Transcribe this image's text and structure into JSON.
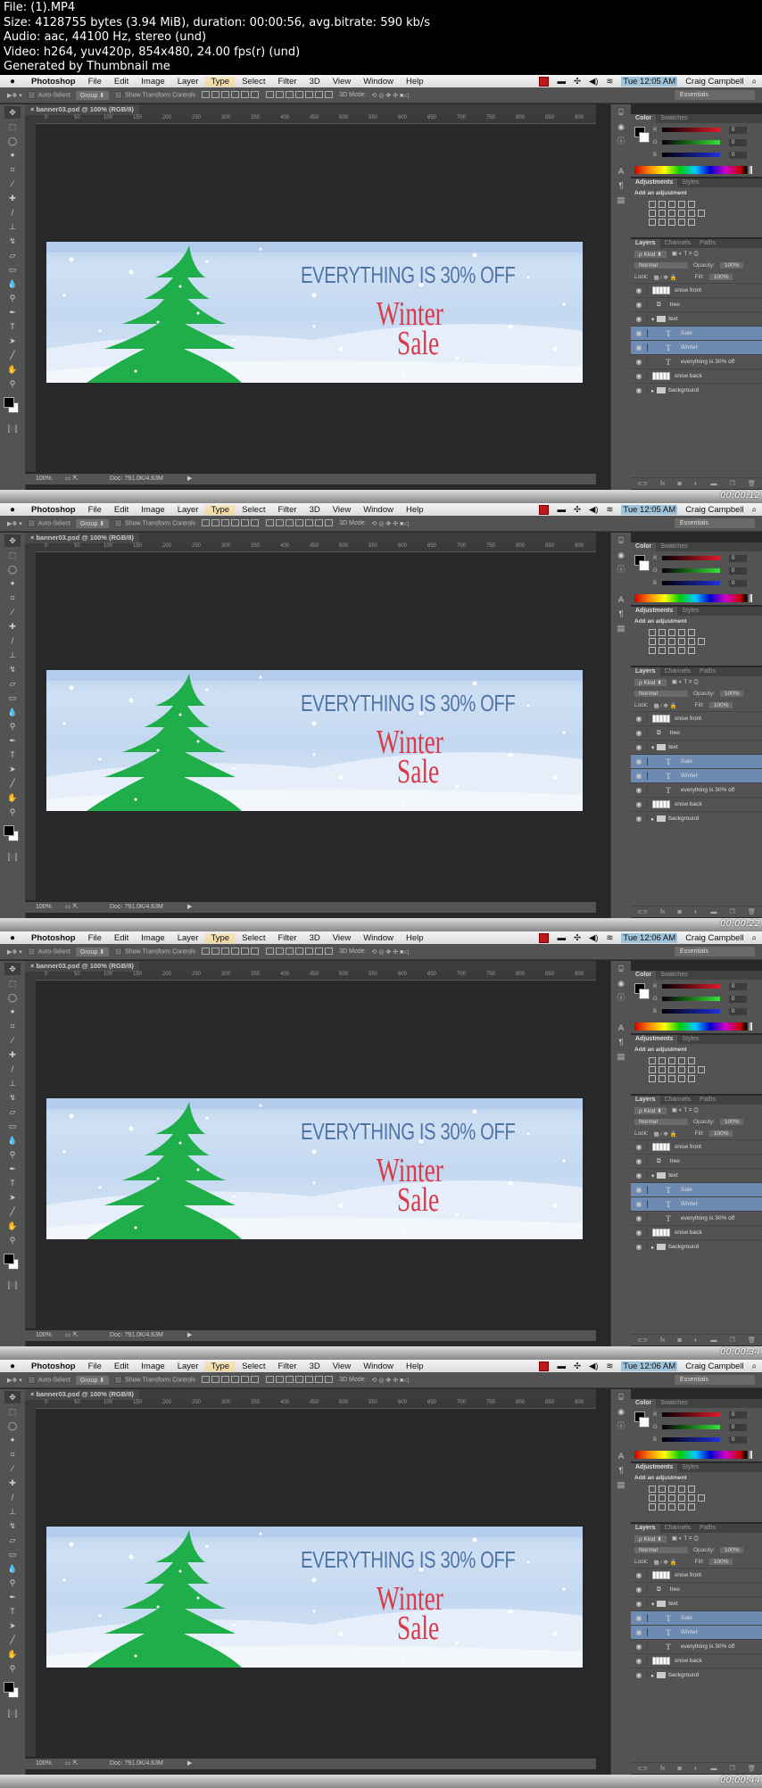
{
  "header": {
    "lines": [
      "File:  (1).MP4",
      "Size: 4128755 bytes (3.94 MiB), duration: 00:00:56, avg.bitrate: 590 kb/s",
      "Audio: aac, 44100 Hz, stereo (und)",
      "Video: h264, yuv420p, 854x480, 24.00 fps(r) (und)",
      "Generated by Thumbnail me"
    ]
  },
  "menubar": {
    "apple": "",
    "items": [
      "Photoshop",
      "File",
      "Edit",
      "Image",
      "Layer",
      "Type",
      "Select",
      "Filter",
      "3D",
      "View",
      "Window",
      "Help"
    ],
    "user": "Craig Campbell",
    "search_icon": "⌕"
  },
  "options": {
    "auto_select_label": "Auto-Select",
    "group_value": "Group ⬍",
    "show_transform_label": "Show Transform Controls",
    "mode_3d_label": "3D Mode:",
    "workspace": "Essentials"
  },
  "document": {
    "tab_title": "banner03.psd @ 100% (RGB/8)",
    "ruler_ticks": [
      "0",
      "50",
      "100",
      "150",
      "200",
      "250",
      "300",
      "350",
      "400",
      "450",
      "500",
      "550",
      "600",
      "650",
      "700",
      "750",
      "800",
      "850",
      "900"
    ],
    "zoom": "100%",
    "doc_size": "Doc: 791.0K/4.63M"
  },
  "banner": {
    "headline": "EVERYTHING IS 30% OFF",
    "line1": "Winter",
    "line2": "Sale",
    "colors": {
      "headline": "#4e74a8",
      "title": "#d83a4a",
      "tree": "#1fae4a",
      "sky": "#c3d8f0"
    }
  },
  "color_panel": {
    "tabs": [
      "Color",
      "Swatches"
    ],
    "channels": [
      {
        "label": "R",
        "value": "0"
      },
      {
        "label": "G",
        "value": "0"
      },
      {
        "label": "B",
        "value": "0"
      }
    ]
  },
  "adjustments_panel": {
    "tabs": [
      "Adjustments",
      "Styles"
    ],
    "title": "Add an adjustment"
  },
  "layers_panel": {
    "tabs": [
      "Layers",
      "Channels",
      "Paths"
    ],
    "kind_filter": "ρ Kind ⬍",
    "blend_mode": "Normal",
    "opacity_label": "Opacity:",
    "opacity_value": "100%",
    "lock_label": "Lock:",
    "fill_label": "Fill:",
    "fill_value": "100%",
    "layers": [
      {
        "name": "snow front",
        "type": "pixel",
        "selected": false
      },
      {
        "name": "tree",
        "type": "smart",
        "selected": false
      },
      {
        "name": "text",
        "type": "group-open",
        "selected": false
      },
      {
        "name": "Sale",
        "type": "text",
        "selected": true
      },
      {
        "name": "Winter",
        "type": "text",
        "selected": true
      },
      {
        "name": "everything is 30% off",
        "type": "text",
        "selected": false
      },
      {
        "name": "snow back",
        "type": "pixel",
        "selected": false
      },
      {
        "name": "background",
        "type": "group-closed",
        "selected": false
      }
    ]
  },
  "frames": [
    {
      "clock": "Tue 12:05 AM",
      "timecode": "00:00:12"
    },
    {
      "clock": "Tue 12:05 AM",
      "timecode": "00:00:22"
    },
    {
      "clock": "Tue 12:06 AM",
      "timecode": "00:00:34"
    },
    {
      "clock": "Tue 12:06 AM",
      "timecode": "00:00:44"
    }
  ]
}
